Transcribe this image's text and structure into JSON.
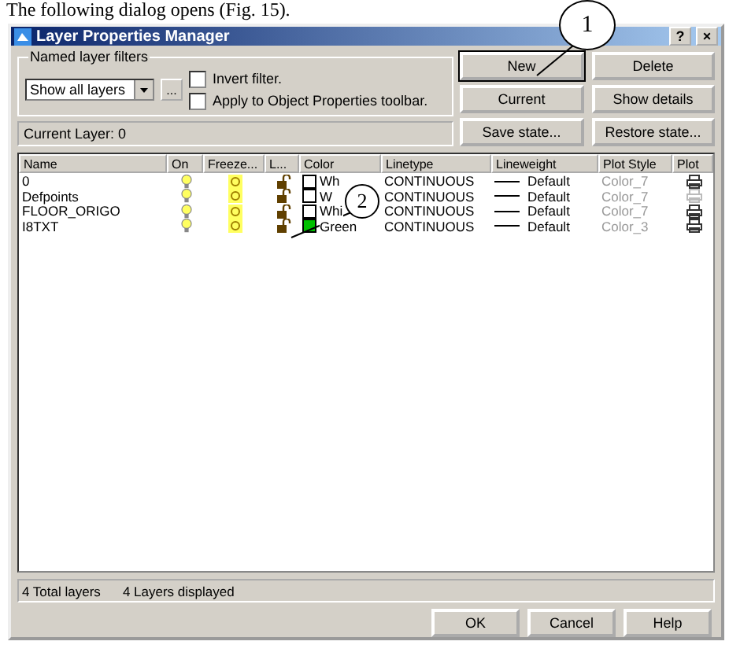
{
  "caption": "The following dialog opens (Fig. 15).",
  "window": {
    "title": "Layer Properties Manager",
    "help": "?",
    "close": "×"
  },
  "filters": {
    "legend": "Named layer filters",
    "value": "Show all layers",
    "more": "...",
    "options": [
      {
        "label": "Invert filter.",
        "checked": false
      },
      {
        "label": "Apply to Object Properties toolbar.",
        "checked": false
      }
    ]
  },
  "current_layer": "Current Layer:  0",
  "buttons": [
    {
      "label": "New",
      "focused": true
    },
    {
      "label": "Delete",
      "focused": false
    },
    {
      "label": "Current",
      "focused": false
    },
    {
      "label": "Show details",
      "focused": false
    },
    {
      "label": "Save state...",
      "focused": false
    },
    {
      "label": "Restore state...",
      "focused": false
    }
  ],
  "table": {
    "columns": [
      "Name",
      "On",
      "Freeze...",
      "L...",
      "Color",
      "Linetype",
      "Lineweight",
      "Plot Style",
      "Plot"
    ],
    "rows": [
      {
        "name": "0",
        "on": true,
        "frozen": false,
        "locked": false,
        "color": "#ffffff",
        "color_name": "Wh",
        "linetype": "CONTINUOUS",
        "lineweight": "Default",
        "plot_style": "Color_7",
        "plot": true
      },
      {
        "name": "Defpoints",
        "on": true,
        "frozen": false,
        "locked": false,
        "color": "#ffffff",
        "color_name": "W",
        "linetype": "CONTINUOUS",
        "lineweight": "Default",
        "plot_style": "Color_7",
        "plot": false
      },
      {
        "name": "FLOOR_ORIGO",
        "on": true,
        "frozen": false,
        "locked": false,
        "color": "#ffffff",
        "color_name": "Whi",
        "linetype": "CONTINUOUS",
        "lineweight": "Default",
        "plot_style": "Color_7",
        "plot": true
      },
      {
        "name": "I8TXT",
        "on": true,
        "frozen": false,
        "locked": false,
        "color": "#00c000",
        "color_name": "Green",
        "linetype": "CONTINUOUS",
        "lineweight": "Default",
        "plot_style": "Color_3",
        "plot": true
      }
    ]
  },
  "status": [
    "4 Total layers",
    "4 Layers displayed"
  ],
  "footer_buttons": [
    "OK",
    "Cancel",
    "Help"
  ],
  "callouts": [
    {
      "label": "1"
    },
    {
      "label": "2"
    }
  ]
}
